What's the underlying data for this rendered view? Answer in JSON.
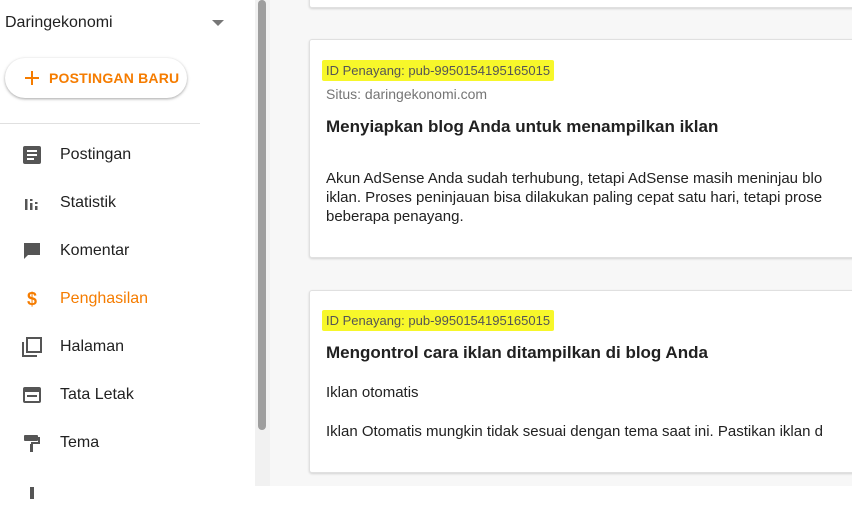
{
  "sidebar": {
    "blog_name": "Daringekonomi",
    "new_post_label": "POSTINGAN BARU",
    "items": [
      {
        "label": "Postingan",
        "icon": "posts-icon"
      },
      {
        "label": "Statistik",
        "icon": "stats-icon"
      },
      {
        "label": "Komentar",
        "icon": "comment-icon"
      },
      {
        "label": "Penghasilan",
        "icon": "dollar-icon",
        "active": true
      },
      {
        "label": "Halaman",
        "icon": "pages-icon"
      },
      {
        "label": "Tata Letak",
        "icon": "layout-icon"
      },
      {
        "label": "Tema",
        "icon": "theme-icon"
      }
    ]
  },
  "main": {
    "cards": [
      {
        "publisher_id": "ID Penayang: pub-9950154195165015",
        "site": "Situs: daringekonomi.com",
        "title": "Menyiapkan blog Anda untuk menampilkan iklan",
        "body": [
          "Akun AdSense Anda sudah terhubung, tetapi AdSense masih meninjau blo",
          "iklan. Proses peninjauan bisa dilakukan paling cepat satu hari, tetapi prose",
          "beberapa penayang."
        ]
      },
      {
        "publisher_id": "ID Penayang: pub-9950154195165015",
        "title": "Mengontrol cara iklan ditampilkan di blog Anda",
        "subtitle": "Iklan otomatis",
        "body": [
          "Iklan Otomatis mungkin tidak sesuai dengan tema saat ini. Pastikan iklan d"
        ]
      }
    ]
  },
  "colors": {
    "accent": "#f57c00",
    "highlight": "#f7f72a",
    "icon": "#555555"
  }
}
